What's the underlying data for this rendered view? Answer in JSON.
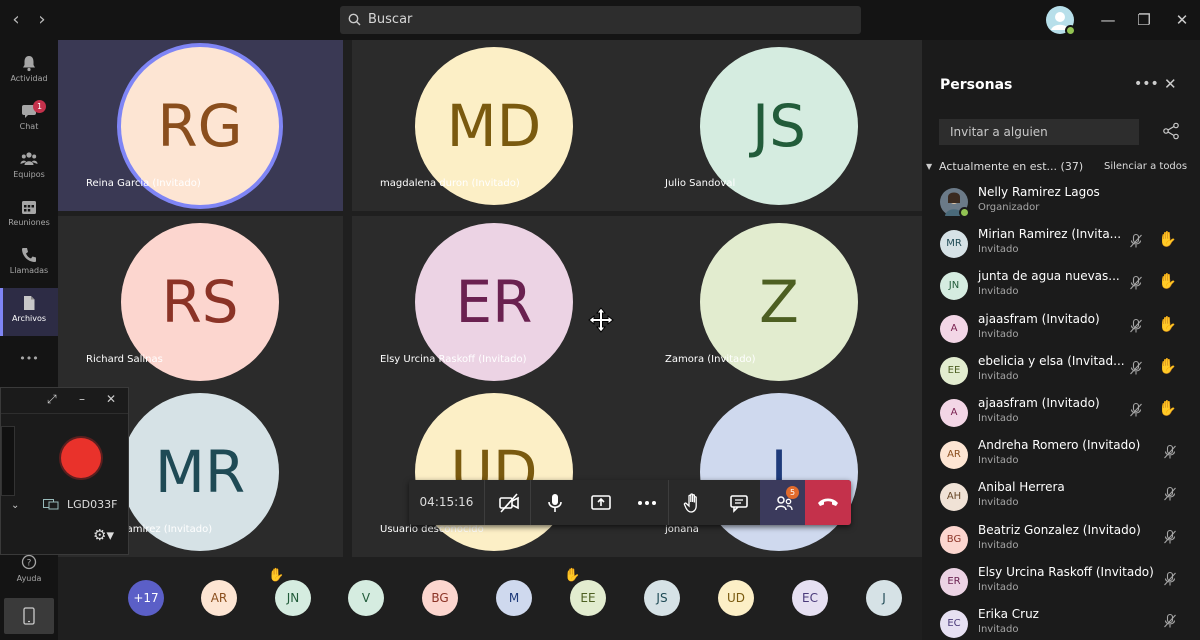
{
  "titlebar": {
    "search_placeholder": "Buscar",
    "back_glyph": "‹",
    "forward_glyph": "›",
    "minimize_glyph": "—",
    "restore_glyph": "❐",
    "close_glyph": "✕"
  },
  "rail": {
    "items": [
      {
        "label": "Actividad",
        "icon": "bell-icon"
      },
      {
        "label": "Chat",
        "icon": "chat-icon",
        "badge": "1"
      },
      {
        "label": "Equipos",
        "icon": "teams-icon"
      },
      {
        "label": "Reuniones",
        "icon": "calendar-icon"
      },
      {
        "label": "Llamadas",
        "icon": "phone-icon"
      },
      {
        "label": "Archivos",
        "icon": "file-icon",
        "active": true
      }
    ],
    "more_glyph": "•••",
    "help_label": "Ayuda"
  },
  "tiles": [
    {
      "initials": "RG",
      "name": "Reina Garcia (Invitado)",
      "bg": "#fde5d3",
      "fg": "#8a4e1d",
      "speaking": true
    },
    {
      "initials": "MD",
      "name": "magdalena duron (Invitado)",
      "bg": "#fcefc6",
      "fg": "#7a5a0f"
    },
    {
      "initials": "JS",
      "name": "Julio Sandoval",
      "bg": "#d5ece0",
      "fg": "#225c3a"
    },
    {
      "initials": "RS",
      "name": "Richard Salinas",
      "bg": "#fcd6cf",
      "fg": "#8b3326"
    },
    {
      "initials": "ER",
      "name": "Elsy Urcina Raskoff (Invitado)",
      "bg": "#ecd3e4",
      "fg": "#6a2150"
    },
    {
      "initials": "Z",
      "name": "Zamora (Invitado)",
      "bg": "#e2eccf",
      "fg": "#4d5f22"
    },
    {
      "initials": "MR",
      "name": "Mirian Ramirez (Invitado)",
      "bg": "#d6e2e6",
      "fg": "#1f4a55"
    },
    {
      "initials": "UD",
      "name": "Usuario desconocido",
      "bg": "#fcefc6",
      "fg": "#7a5a0f"
    },
    {
      "initials": "J",
      "name": "jonana",
      "bg": "#cfd9ee",
      "fg": "#1e3a7a"
    }
  ],
  "controls": {
    "timer": "04:15:16",
    "people_badge": "5"
  },
  "recorder": {
    "device": "LGD033F",
    "maximize_glyph": "⤢",
    "minimize_glyph": "–",
    "close_glyph": "✕",
    "chevron_glyph": "⌄",
    "gear_glyph": "⚙▾"
  },
  "strip": [
    {
      "initials": "+17",
      "bg": "#5b5fc7",
      "fg": "#ffffff"
    },
    {
      "initials": "AR",
      "bg": "#fde5d3",
      "fg": "#8a4e1d"
    },
    {
      "initials": "JN",
      "bg": "#d5ece0",
      "fg": "#225c3a",
      "hand": true
    },
    {
      "initials": "V",
      "bg": "#d5ece0",
      "fg": "#225c3a"
    },
    {
      "initials": "BG",
      "bg": "#fcd6cf",
      "fg": "#8b3326"
    },
    {
      "initials": "M",
      "bg": "#cfd9ee",
      "fg": "#1e3a7a"
    },
    {
      "initials": "EE",
      "bg": "#e2eccf",
      "fg": "#4d5f22",
      "hand": true
    },
    {
      "initials": "JS",
      "bg": "#d6e2e6",
      "fg": "#1f4a55"
    },
    {
      "initials": "UD",
      "bg": "#fcefc6",
      "fg": "#7a5a0f"
    },
    {
      "initials": "EC",
      "bg": "#e6e0f2",
      "fg": "#4a3a7a"
    },
    {
      "initials": "J",
      "bg": "#d6e2e6",
      "fg": "#1f4a55"
    }
  ],
  "panel": {
    "title": "Personas",
    "more_glyph": "•••",
    "close_glyph": "✕",
    "invite_placeholder": "Invitar a alguien",
    "section_label": "Actualmente en est...",
    "section_count": "(37)",
    "mute_all": "Silenciar a todos",
    "caret_glyph": "▼",
    "hand_glyph": "✋",
    "people": [
      {
        "initials": "",
        "name": "Nelly Ramirez Lagos",
        "role": "Organizador",
        "bg": "#6b7a88",
        "fg": "#fff",
        "photo": true
      },
      {
        "initials": "MR",
        "name": "Mirian Ramirez (Invita...",
        "role": "Invitado",
        "bg": "#d6e2e6",
        "fg": "#1f4a55",
        "hand": true
      },
      {
        "initials": "JN",
        "name": "junta de agua nuevas...",
        "role": "Invitado",
        "bg": "#d5ece0",
        "fg": "#225c3a",
        "hand": true
      },
      {
        "initials": "A",
        "name": "ajaasfram (Invitado)",
        "role": "Invitado",
        "bg": "#f3d6e6",
        "fg": "#7a2150",
        "hand": true
      },
      {
        "initials": "EE",
        "name": "ebelicia y elsa (Invitad...",
        "role": "Invitado",
        "bg": "#e2eccf",
        "fg": "#4d5f22",
        "hand": true
      },
      {
        "initials": "A",
        "name": "ajaasfram (Invitado)",
        "role": "Invitado",
        "bg": "#f3d6e6",
        "fg": "#7a2150",
        "hand": true
      },
      {
        "initials": "AR",
        "name": "Andreha Romero (Invitado)",
        "role": "Invitado",
        "bg": "#fde5d3",
        "fg": "#8a4e1d"
      },
      {
        "initials": "AH",
        "name": "Anibal Herrera",
        "role": "Invitado",
        "bg": "#f0e2d6",
        "fg": "#6a4a2a"
      },
      {
        "initials": "BG",
        "name": "Beatriz Gonzalez (Invitado)",
        "role": "Invitado",
        "bg": "#fcd6cf",
        "fg": "#8b3326"
      },
      {
        "initials": "ER",
        "name": "Elsy Urcina Raskoff (Invitado)",
        "role": "Invitado",
        "bg": "#ecd3e4",
        "fg": "#6a2150"
      },
      {
        "initials": "EC",
        "name": "Erika Cruz",
        "role": "Invitado",
        "bg": "#e6e0f2",
        "fg": "#4a3a7a"
      }
    ]
  }
}
